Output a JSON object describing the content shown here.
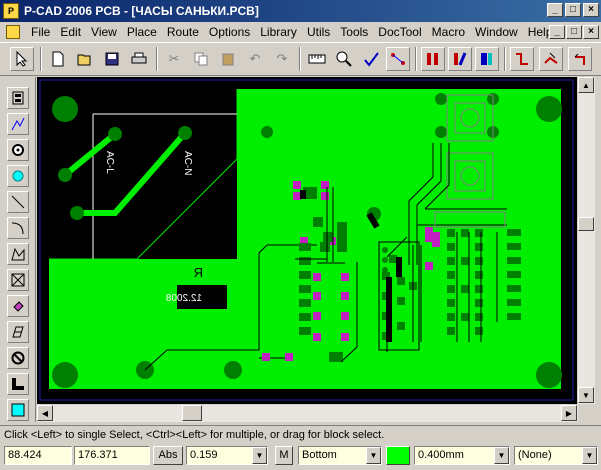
{
  "window": {
    "title": "P-CAD 2006 PCB - [ЧАСЫ САНЬКИ.PCB]",
    "minimize": "_",
    "maximize": "□",
    "close": "×"
  },
  "menu": {
    "items": [
      "File",
      "Edit",
      "View",
      "Place",
      "Route",
      "Options",
      "Library",
      "Utils",
      "Tools",
      "DocTool",
      "Macro",
      "Window",
      "Help"
    ]
  },
  "canvas": {
    "labels": {
      "acl": "AC-L",
      "acn": "AC-N",
      "ref": "R",
      "date": "12.2008"
    }
  },
  "status": {
    "hint": "Click <Left> to single Select, <Ctrl><Left> for multiple, or drag for block select."
  },
  "bottom": {
    "x_coord": "88.424",
    "y_coord": "176.371",
    "abs_label": "Abs",
    "grid_value": "0.159",
    "m_label": "M",
    "layer": "Bottom",
    "width": "0.400mm",
    "net": "(None)"
  },
  "colors": {
    "board": "#00ee00",
    "background": "#000000",
    "via_pads": "#008000",
    "smd_pads": "#c020c0",
    "titlebar": "#0a246a",
    "layer_swatch": "#00ff00"
  },
  "icons": {
    "toolbar": [
      "select-arrow-icon",
      "new-file-icon",
      "open-folder-icon",
      "save-icon",
      "print-icon",
      "cut-icon",
      "copy-icon",
      "paste-icon",
      "undo-icon",
      "redo-icon",
      "ruler-icon",
      "zoom-icon",
      "drc-icon",
      "route-icon",
      "layer-red-icon",
      "layer-mixed-icon",
      "layer-blue-icon",
      "trace-icon",
      "reroute-icon",
      "undo-route-icon"
    ],
    "palette": [
      "pad-icon",
      "line-route-icon",
      "via-icon",
      "point-icon",
      "line-icon",
      "arc-icon",
      "polygon-icon",
      "copper-pour-icon",
      "pour-fill-icon",
      "cutout-icon",
      "keepout-icon",
      "text-icon",
      "attribute-icon"
    ]
  }
}
